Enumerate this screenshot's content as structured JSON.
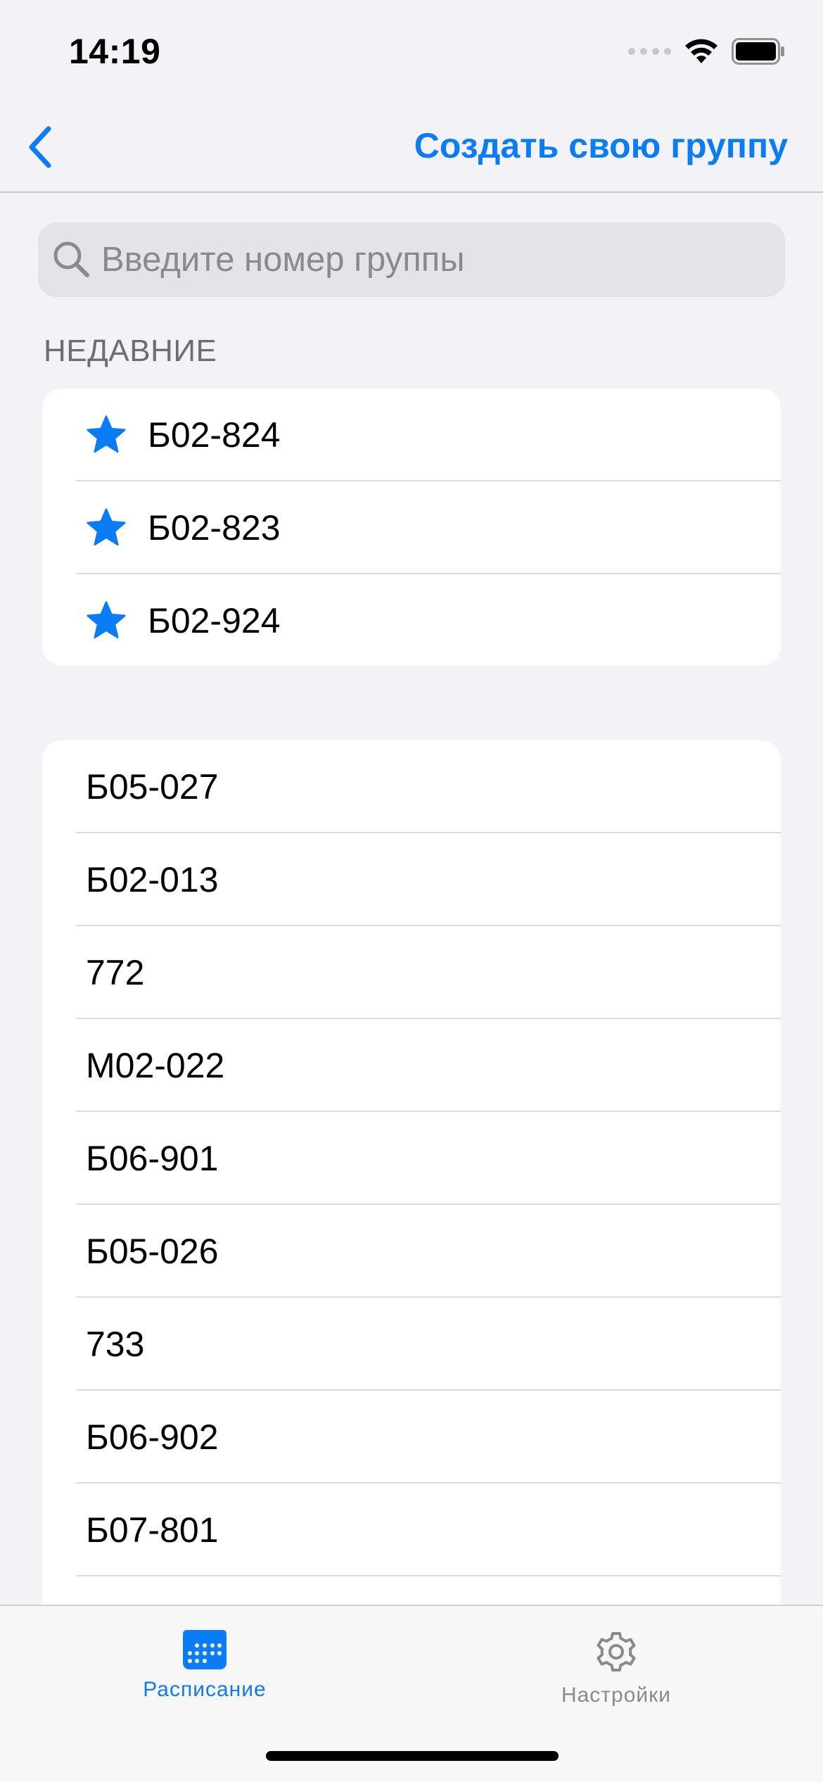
{
  "status_bar": {
    "time": "14:19"
  },
  "nav": {
    "create_group_label": "Создать свою группу"
  },
  "search": {
    "placeholder": "Введите номер группы",
    "value": ""
  },
  "recent": {
    "header": "НЕДАВНИЕ",
    "items": [
      {
        "label": "Б02-824"
      },
      {
        "label": "Б02-823"
      },
      {
        "label": "Б02-924"
      }
    ]
  },
  "groups": {
    "items": [
      {
        "label": "Б05-027"
      },
      {
        "label": "Б02-013"
      },
      {
        "label": "772"
      },
      {
        "label": "М02-022"
      },
      {
        "label": "Б06-901"
      },
      {
        "label": "Б05-026"
      },
      {
        "label": "733"
      },
      {
        "label": "Б06-902"
      },
      {
        "label": "Б07-801"
      }
    ]
  },
  "tabs": [
    {
      "label": "Расписание",
      "icon": "calendar-icon",
      "active": true
    },
    {
      "label": "Настройки",
      "icon": "gear-icon",
      "active": false
    }
  ],
  "colors": {
    "accent": "#0a7cf5",
    "background": "#f2f2f7",
    "inactive": "#8a8a8e"
  }
}
